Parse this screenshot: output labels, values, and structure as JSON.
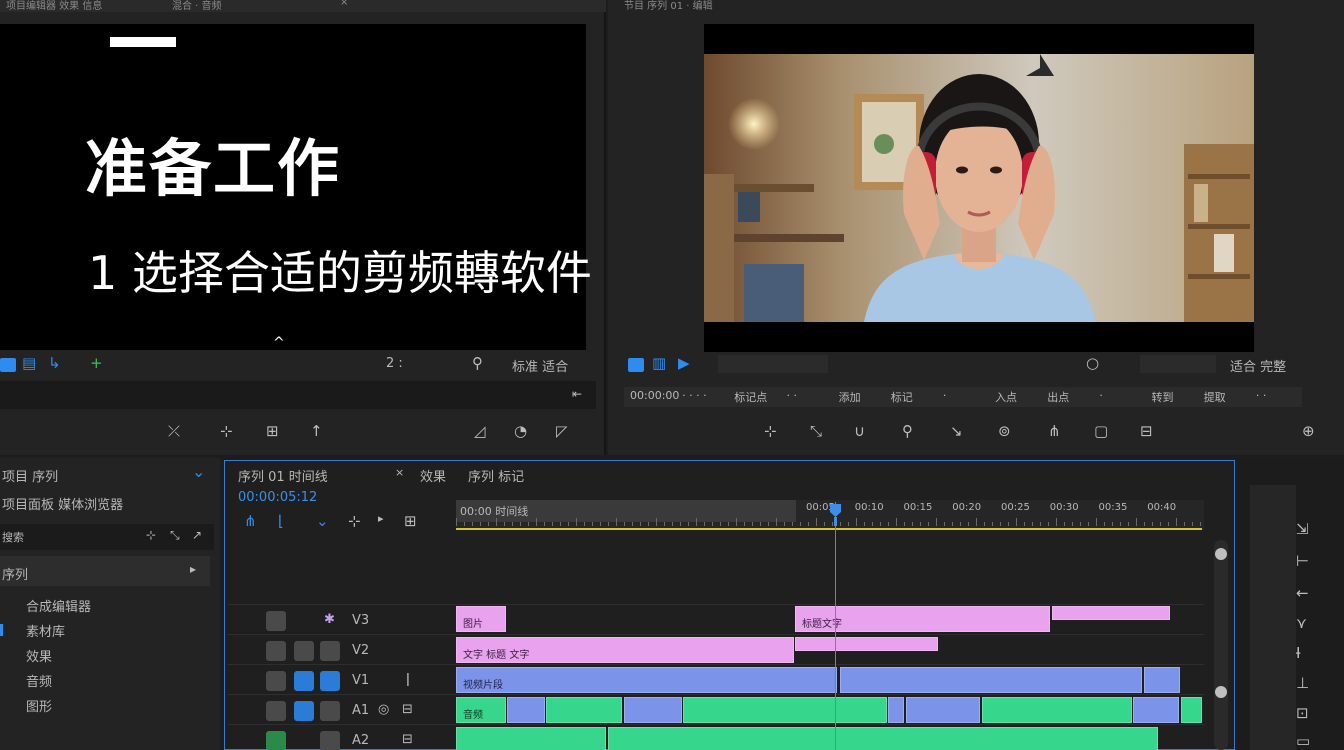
{
  "source_monitor": {
    "tab_text_1": "项目编辑器 效果 信息",
    "tab_text_2": "混合 · 音频",
    "tab_close": "×",
    "title": "准备工作",
    "subtitle": "1 选择合适的剪频轉软件",
    "caret": "^",
    "ctrl_right_1": "2 :",
    "ctrl_right_2": "标准 适合",
    "scrub_icon": "⇤"
  },
  "program_monitor": {
    "tab_text": "节目 序列 01 · 编辑"
  },
  "program_controls": {
    "right_label": "适合 完整"
  },
  "program_ruler": {
    "items": [
      "00:00:00",
      "· · · ·",
      "标记点",
      "· ·",
      "添加",
      "标记",
      "·",
      "入点",
      "出点",
      "·",
      "转到",
      "提取",
      "· ·"
    ]
  },
  "project_panel": {
    "header": "项目 序列",
    "path": "项目面板 媒体浏览器",
    "search_label": "搜索",
    "section": "序列",
    "items": [
      "合成编辑器",
      "素材库",
      "效果",
      "音频",
      "图形"
    ]
  },
  "timeline": {
    "title": "序列 01 时间线",
    "tab_2": "效果",
    "tab_3": "序列 标记",
    "timecode": "00:00:05:12",
    "ruler_label": "00:00 时间线",
    "ruler_marks": [
      "00:05",
      "00:10",
      "00:15",
      "00:20",
      "00:25",
      "00:30",
      "00:35",
      "00:40"
    ],
    "tracks": [
      {
        "name": "V3"
      },
      {
        "name": "V2"
      },
      {
        "name": "V1"
      },
      {
        "name": "A1"
      },
      {
        "name": "A2"
      }
    ],
    "clip_labels": {
      "pink1": "图片",
      "pink2": "标题文字",
      "pink3": "文字 标题 文字",
      "blue1": "视频片段",
      "green1": "音频"
    }
  },
  "colors": {
    "accent": "#2e8cf0",
    "pink_clip": "#e8a2ee",
    "blue_clip": "#7c93ea",
    "green_clip": "#36d68c",
    "work_area": "#d7c232"
  }
}
